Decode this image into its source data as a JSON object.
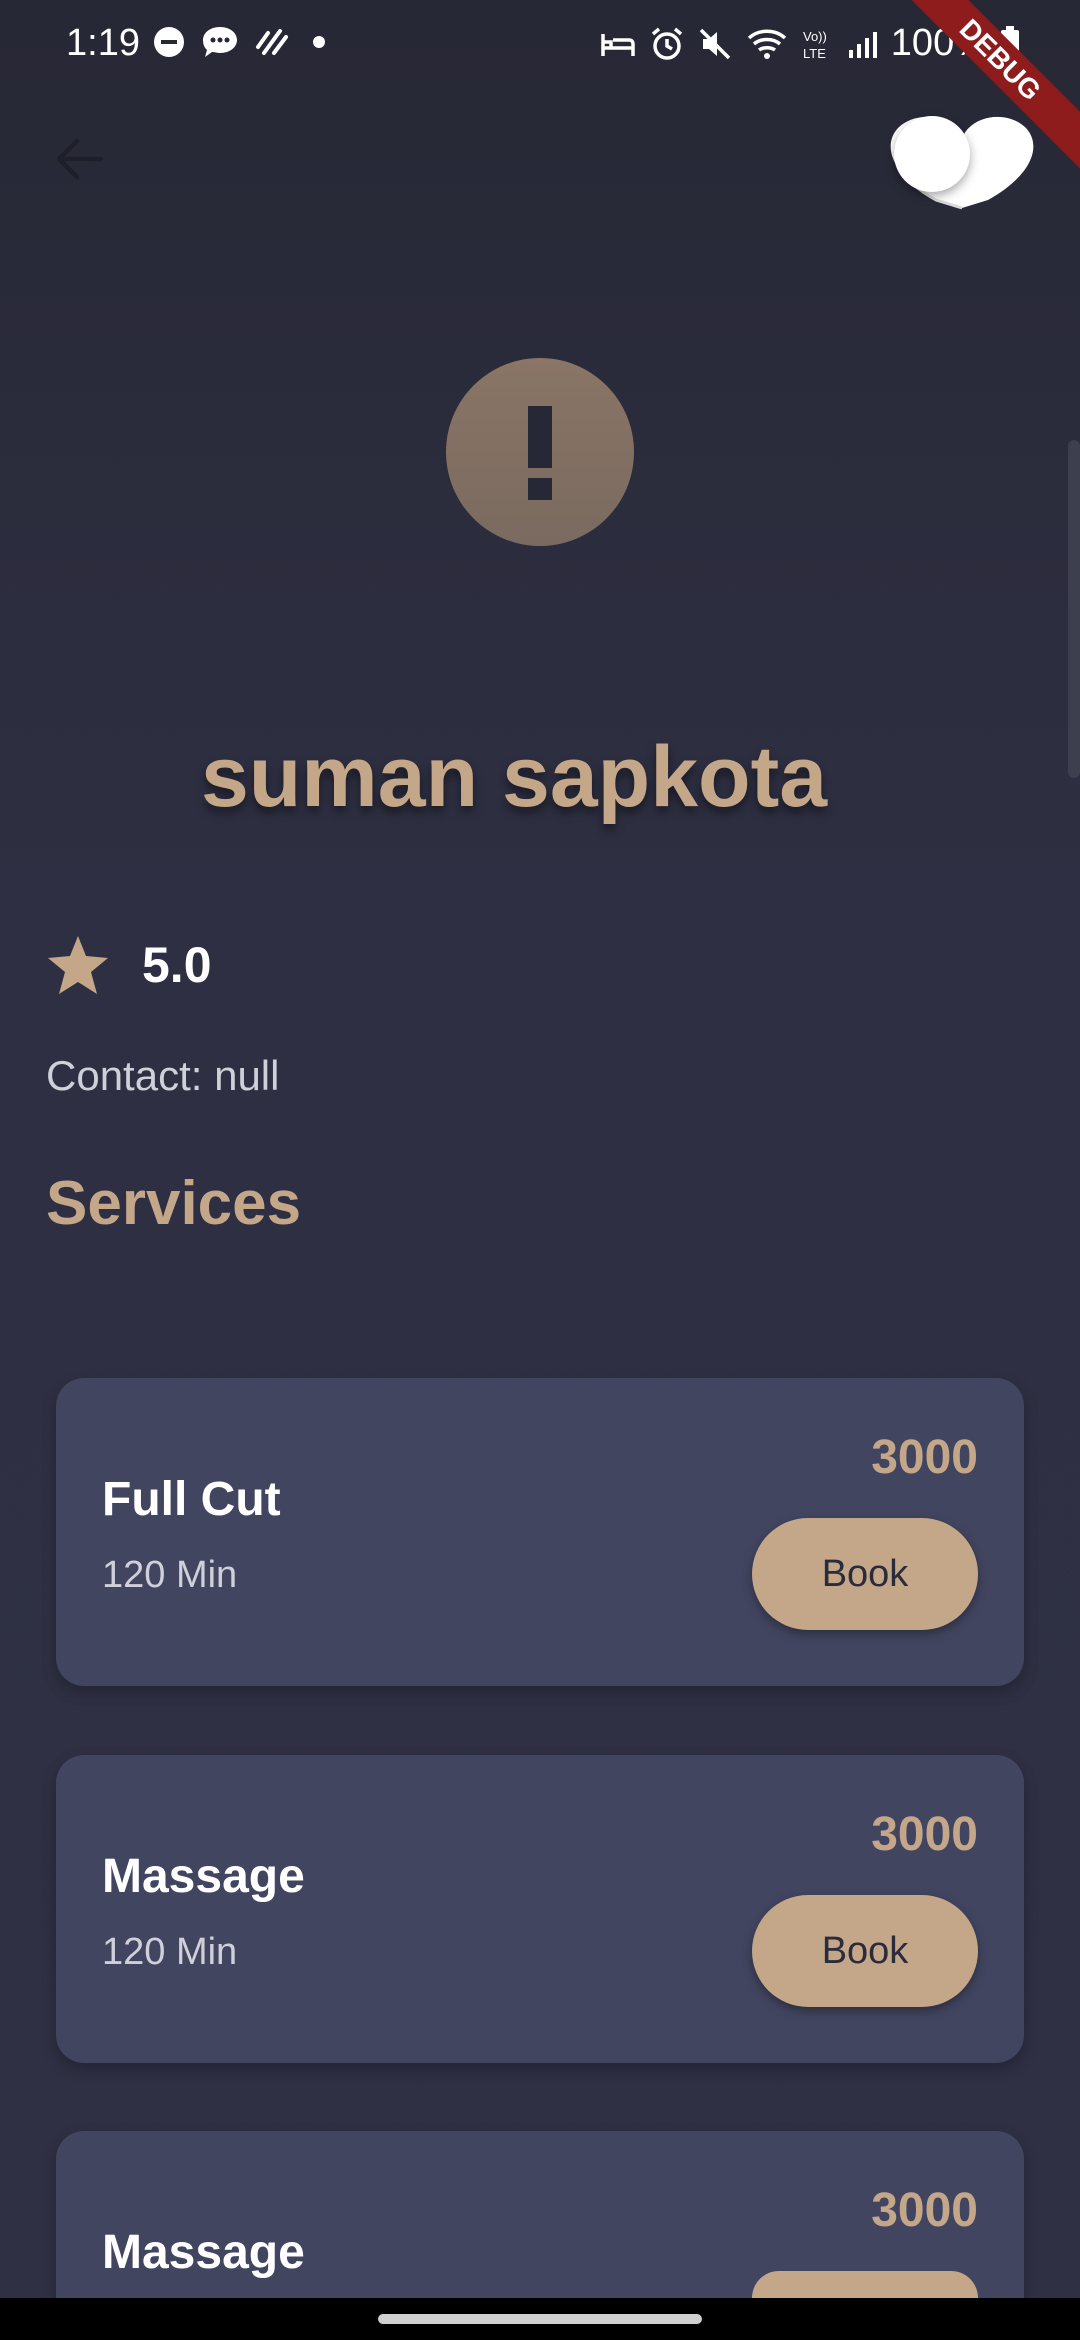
{
  "status_bar": {
    "time": "1:19",
    "battery": "100%",
    "debug_label": "DEBUG",
    "left_icons": [
      "dnd-icon",
      "message-icon",
      "activity-icon",
      "dot-icon"
    ],
    "right_icons": [
      "sleep-icon",
      "alarm-icon",
      "mute-icon",
      "wifi-icon",
      "volte-icon",
      "signal-icon",
      "battery-icon"
    ]
  },
  "app_bar": {
    "back_icon": "arrow-left-icon",
    "toggle_icon": "theme-toggle-icon"
  },
  "profile": {
    "avatar_icon": "exclamation-icon",
    "name": "suman sapkota",
    "rating": "5.0",
    "contact": "Contact: null"
  },
  "services": {
    "title": "Services",
    "items": [
      {
        "name": "Full Cut",
        "duration": "120 Min",
        "price": "3000",
        "button": "Book"
      },
      {
        "name": "Massage",
        "duration": "120 Min",
        "price": "3000",
        "button": "Book"
      },
      {
        "name": "Massage",
        "duration": "",
        "price": "3000",
        "button": ""
      }
    ]
  },
  "colors": {
    "accent": "#c4a689",
    "card": "#424560",
    "background": "#2e2f42"
  }
}
